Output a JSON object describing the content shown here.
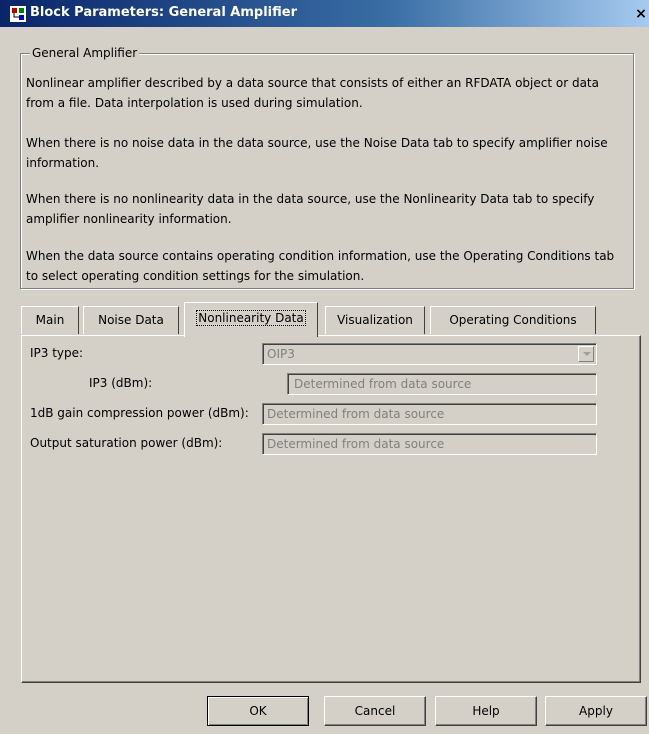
{
  "window": {
    "title": "Block Parameters: General Amplifier",
    "close": "×"
  },
  "group": {
    "legend": "General Amplifier",
    "paragraphs": [
      "Nonlinear amplifier described by a data source that consists of either an RFDATA object or data from a file. Data interpolation is used during simulation.",
      "When there is no noise data in the data source, use the Noise Data tab to specify amplifier noise information.",
      "When there is no nonlinearity data in the data source, use the Nonlinearity Data tab to specify amplifier nonlinearity information.",
      "When the data source contains operating condition information, use the Operating Conditions tab to select operating condition settings for the simulation."
    ]
  },
  "tabs": [
    {
      "label": "Main"
    },
    {
      "label": "Noise Data"
    },
    {
      "label": "Nonlinearity Data",
      "active": true
    },
    {
      "label": "Visualization"
    },
    {
      "label": "Operating Conditions"
    }
  ],
  "form": {
    "ip3_type_label": "IP3 type:",
    "ip3_type_value": "OIP3",
    "ip3_label": "IP3 (dBm):",
    "ip3_value": "Determined from data source",
    "gain_comp_label": "1dB gain compression power (dBm):",
    "gain_comp_value": "Determined from data source",
    "out_sat_label": "Output saturation power (dBm):",
    "out_sat_value": "Determined from data source"
  },
  "buttons": {
    "ok": "OK",
    "cancel": "Cancel",
    "help": "Help",
    "apply": "Apply"
  },
  "colors": {
    "title_bar": "#0a246a",
    "dialog_bg": "#d4d0c8"
  }
}
